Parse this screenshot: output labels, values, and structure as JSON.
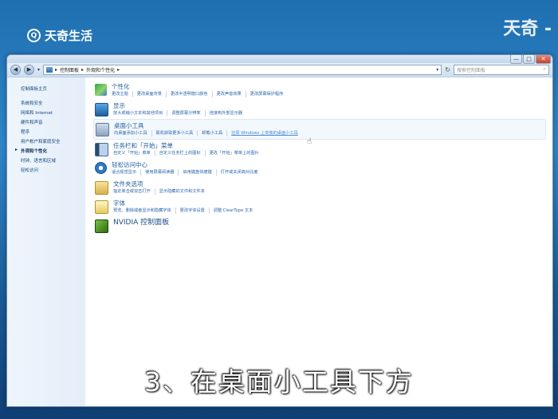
{
  "watermark": {
    "logo_text": "天奇生活",
    "logo_glyph": "Q",
    "right_text": "天奇 -"
  },
  "window": {
    "controls": {
      "minimize": "—",
      "maximize": "□",
      "close": "✕"
    },
    "nav": {
      "back": "◀",
      "forward": "▶",
      "dropdown": "▾",
      "refresh": "↻"
    },
    "address": {
      "path": [
        "控制面板",
        "外观和个性化"
      ],
      "separator": "▸"
    },
    "search": {
      "placeholder": "搜索控制面板",
      "icon": "search-icon"
    }
  },
  "sidebar": {
    "home": "控制面板主页",
    "items": [
      {
        "label": "系统和安全",
        "active": false
      },
      {
        "label": "网络和 Internet",
        "active": false
      },
      {
        "label": "硬件和声音",
        "active": false
      },
      {
        "label": "程序",
        "active": false
      },
      {
        "label": "用户帐户和家庭安全",
        "active": false
      },
      {
        "label": "外观和个性化",
        "active": true
      },
      {
        "label": "时钟、语言和区域",
        "active": false
      },
      {
        "label": "轻松访问",
        "active": false
      }
    ]
  },
  "categories": [
    {
      "title": "个性化",
      "icon": "personalization-icon",
      "links": [
        "更改主题",
        "更改桌面背景",
        "更改半透明窗口颜色",
        "更改声音效果",
        "更改屏幕保护程序"
      ]
    },
    {
      "title": "显示",
      "icon": "display-icon",
      "links": [
        "放大或缩小文本和其他项目",
        "调整屏幕分辨率",
        "连接到外部显示器"
      ]
    },
    {
      "title": "桌面小工具",
      "icon": "gadgets-icon",
      "links": [
        "向桌面添加小工具",
        "联机获取更多小工具",
        "卸载小工具",
        "还原 Windows 上安装的桌面小工具"
      ],
      "hover_index": 3,
      "highlighted": true
    },
    {
      "title": "任务栏和「开始」菜单",
      "icon": "taskbar-icon",
      "links": [
        "自定义「开始」菜单",
        "自定义任务栏上的图标",
        "更改「开始」菜单上的图片"
      ]
    },
    {
      "title": "轻松访问中心",
      "icon": "ease-of-access-icon",
      "links": [
        "适合视觉显示",
        "使用屏幕阅读器",
        "启用键盘快捷键",
        "打开或关闭高对比度"
      ]
    },
    {
      "title": "文件夹选项",
      "icon": "folder-options-icon",
      "links": [
        "指定单击或双击打开",
        "显示隐藏的文件和文件夹"
      ]
    },
    {
      "title": "字体",
      "icon": "fonts-icon",
      "links": [
        "预览、删除或者显示和隐藏字体",
        "更改字体设置",
        "调整 ClearType 文本"
      ]
    },
    {
      "title": "NVIDIA 控制面板",
      "icon": "nvidia-icon",
      "links": [],
      "big": true
    }
  ],
  "subtitle": "3、在桌面小工具下方"
}
